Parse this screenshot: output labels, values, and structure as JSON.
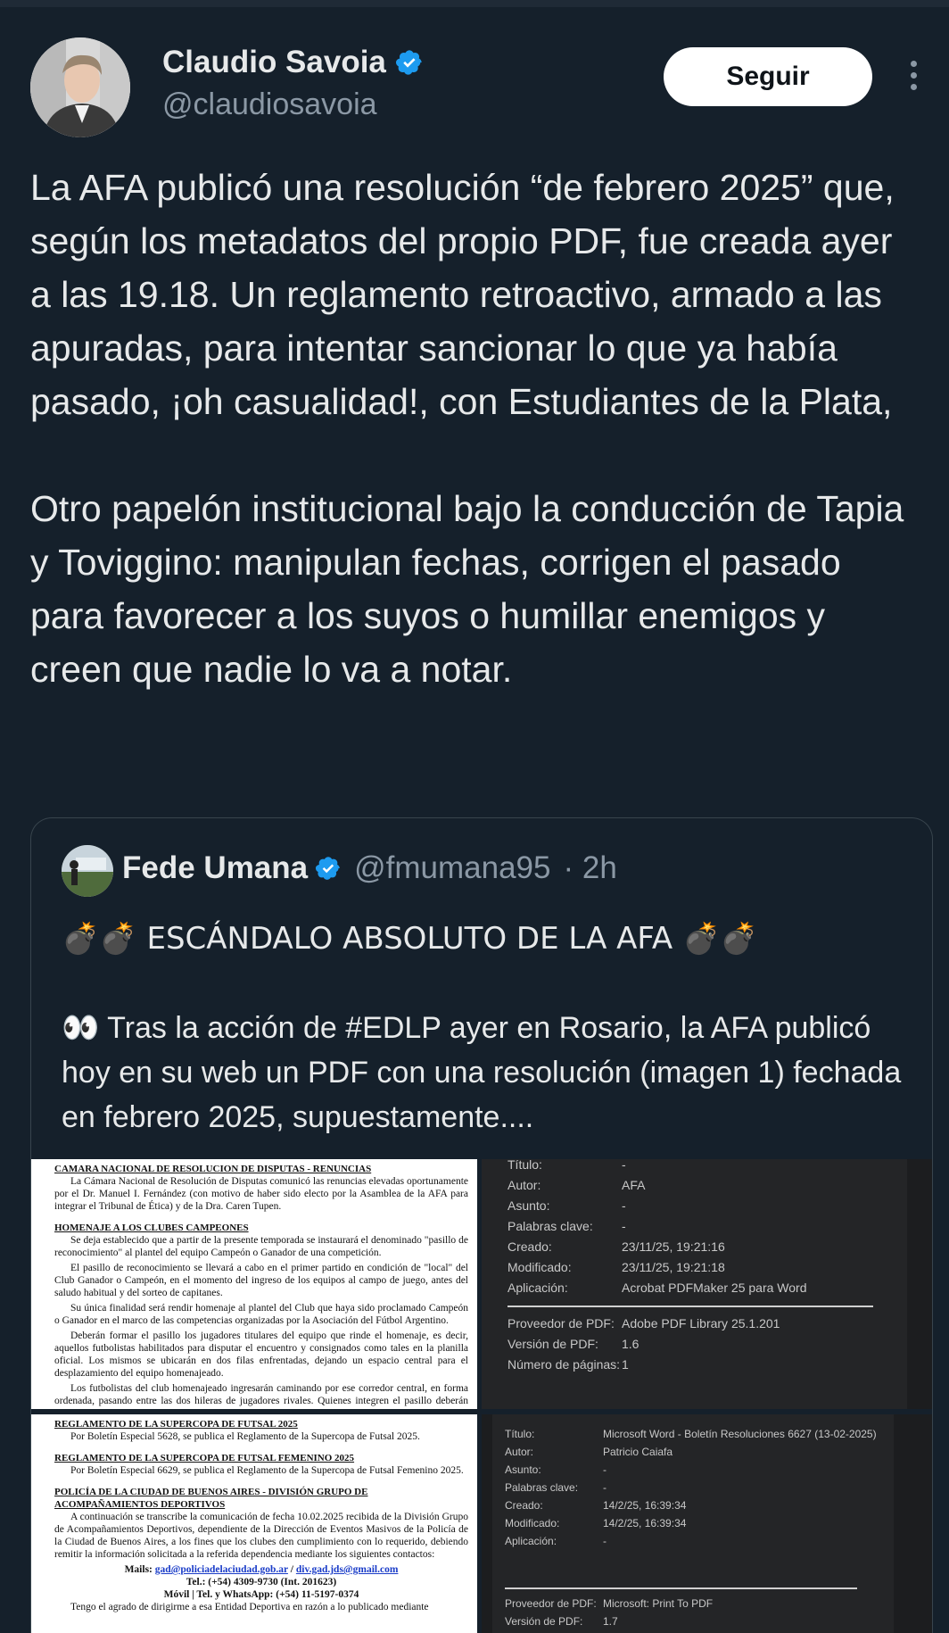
{
  "author": {
    "name": "Claudio Savoia",
    "handle": "@claudiosavoia",
    "follow_label": "Seguir"
  },
  "tweet": {
    "paragraph1": "La AFA publicó una resolución “de febrero 2025” que, según los metadatos del propio PDF, fue creada ayer a las 19.18. Un reglamento retroactivo, armado a las apuradas, para intentar sancionar lo que ya había pasado, ¡oh casualidad!, con Estudiantes de la Plata,",
    "paragraph2": "Otro papelón institucional bajo la conducción de Tapia y Toviggino: manipulan fechas, corrigen el pasado para favorecer a los suyos o humillar enemigos y creen que nadie lo va a notar."
  },
  "quoted": {
    "name": "Fede Umana",
    "handle": "@fmumana95",
    "time": "· 2h",
    "line1": "💣💣 ESCÁNDALO ABSOLUTO DE LA AFA 💣💣",
    "line2": "👀 Tras la acción de #EDLP ayer en Rosario, la AFA publicó hoy en su web un PDF con una resolución (imagen 1) fechada en febrero 2025, supuestamente...."
  },
  "doc1": {
    "heading1": "CAMARA NACIONAL DE RESOLUCION DE DISPUTAS - RENUNCIAS",
    "p1": "La Cámara Nacional de Resolución de Disputas comunicó las renuncias elevadas oportunamente por el Dr. Manuel I. Fernández (con motivo de haber sido electo por la Asamblea de la AFA para integrar el Tribunal de Ética) y de la Dra. Caren Tupen.",
    "heading2": "HOMENAJE A LOS CLUBES CAMPEONES",
    "p2": "Se deja establecido que a partir de la presente temporada se instaurará el denominado \"pasillo de reconocimiento\" al plantel del equipo Campeón o Ganador de una competición.",
    "p3": "El pasillo de reconocimiento se llevará a cabo en el primer partido en condición de \"local\" del Club Ganador o Campeón, en el momento del ingreso de los equipos al campo de juego, antes del saludo habitual y del sorteo de capitanes.",
    "p4": "Su única finalidad será rendir homenaje al plantel del Club que haya sido proclamado Campeón o Ganador en el marco de las competencias organizadas por la Asociación del Fútbol Argentino.",
    "p5": "Deberán formar el pasillo los jugadores titulares del equipo que rinde el homenaje, es decir, aquellos futbolistas habilitados para disputar el encuentro y consignados como tales en la planilla oficial. Los mismos se ubicarán en dos filas enfrentadas, dejando un espacio central para el desplazamiento del equipo homenajeado.",
    "p6": "Los futbolistas del club homenajeado ingresarán caminando por ese corredor central, en forma ordenada, pasando entre las dos hileras de jugadores rivales. Quienes integren el pasillo deberán permanecer en su lugar, mirando a los jugadores que transitan, sin realizar movimientos o conductas que alteren el desarrollo normal del protocolo, procedimiento éste que deberá"
  },
  "meta1": {
    "rows": [
      [
        "Título:",
        "-"
      ],
      [
        "Autor:",
        "AFA"
      ],
      [
        "Asunto:",
        "-"
      ],
      [
        "Palabras clave:",
        "-"
      ],
      [
        "Creado:",
        "23/11/25, 19:21:16"
      ],
      [
        "Modificado:",
        "23/11/25, 19:21:18"
      ],
      [
        "Aplicación:",
        "Acrobat PDFMaker 25 para Word"
      ]
    ],
    "rows2": [
      [
        "Proveedor de PDF:",
        "Adobe PDF Library 25.1.201"
      ],
      [
        "Versión de PDF:",
        "1.6"
      ],
      [
        "Número de páginas:",
        "1"
      ]
    ]
  },
  "doc2": {
    "heading1": "REGLAMENTO DE LA SUPERCOPA DE FUTSAL 2025",
    "p1": "Por Boletín Especial 5628, se publica el Reglamento de la Supercopa de Futsal 2025.",
    "heading2": "REGLAMENTO DE LA SUPERCOPA DE FUTSAL FEMENINO 2025",
    "p2": "Por Boletín Especial 6629, se publica el Reglamento de la Supercopa de Futsal Femenino 2025.",
    "heading3": "POLICÍA DE LA CIUDAD DE BUENOS AIRES - DIVISIÓN GRUPO DE ACOMPAÑAMIENTOS DEPORTIVOS",
    "p3": "A continuación se transcribe la comunicación de fecha 10.02.2025 recibida de la División Grupo de Acompañamientos Deportivos, dependiente de la Dirección de Eventos Masivos de la Policía de la Ciudad de Buenos Aires, a los fines que los clubes den cumplimiento con lo requerido, debiendo remitir la información solicitada a la referida dependencia mediante los siguientes contactos:",
    "mails_label": "Mails:",
    "mail1": "gad@policiadelaciudad.gob.ar",
    "mail2": "div.gad.jds@gmail.com",
    "tel": "Tel.: (+54) 4309-9730 (Int. 201623)",
    "movil": "Móvil | Tel. y WhatsApp: (+54) 11-5197-0374",
    "p4": "Tengo el agrado de dirigirme a esa Entidad Deportiva en razón a lo publicado mediante"
  },
  "meta2": {
    "rows": [
      [
        "Título:",
        "Microsoft Word - Boletín Resoluciones 6627 (13-02-2025)"
      ],
      [
        "Autor:",
        "Patricio Caiafa"
      ],
      [
        "Asunto:",
        "-"
      ],
      [
        "Palabras clave:",
        "-"
      ],
      [
        "Creado:",
        "14/2/25, 16:39:34"
      ],
      [
        "Modificado:",
        "14/2/25, 16:39:34"
      ],
      [
        "Aplicación:",
        "-"
      ]
    ],
    "rows2": [
      [
        "Proveedor de PDF:",
        "Microsoft: Print To PDF"
      ],
      [
        "Versión de PDF:",
        "1.7"
      ]
    ]
  }
}
